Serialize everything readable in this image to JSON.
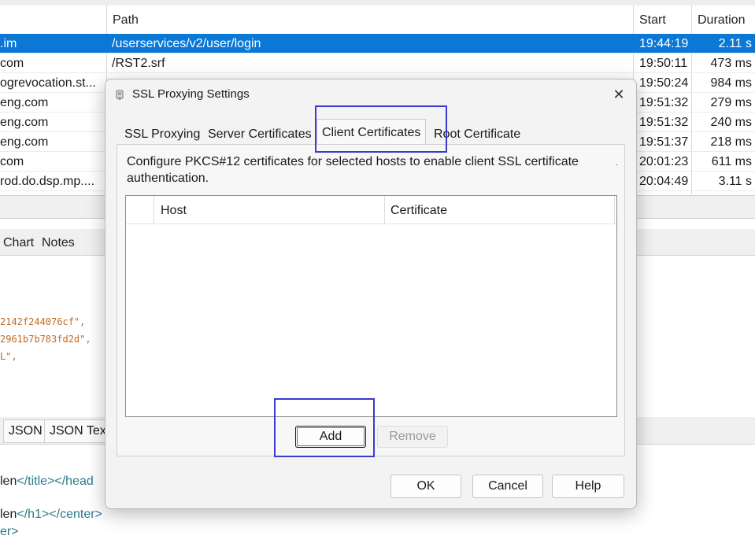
{
  "background": {
    "table": {
      "columns": {
        "path": "Path",
        "start": "Start",
        "duration": "Duration"
      },
      "rows": [
        {
          "host": ".im",
          "path": "/userservices/v2/user/login",
          "start": "19:44:19",
          "duration": "2.11 s",
          "selected": true
        },
        {
          "host": "com",
          "path": "/RST2.srf",
          "start": "19:50:11",
          "duration": "473 ms"
        },
        {
          "host": "ogrevocation.st...",
          "path": "",
          "start": "19:50:24",
          "duration": "984 ms"
        },
        {
          "host": "eng.com",
          "path": "",
          "start": "19:51:32",
          "duration": "279 ms"
        },
        {
          "host": "eng.com",
          "path": "",
          "start": "19:51:32",
          "duration": "240 ms"
        },
        {
          "host": "eng.com",
          "path": "",
          "start": "19:51:37",
          "duration": "218 ms"
        },
        {
          "host": "com",
          "path": "",
          "start": "20:01:23",
          "duration": "611 ms"
        },
        {
          "host": "rod.do.dsp.mp....",
          "path": "",
          "start": "20:04:49",
          "duration": "3.11 s"
        }
      ]
    },
    "lower_tabs": {
      "chart": "Chart",
      "notes": "Notes"
    },
    "code_lines": [
      "2142f244076cf\",",
      "2961b7b783fd2d\",",
      "L\","
    ],
    "response_tabs": {
      "json": "JSON",
      "json_text": "JSON Tex"
    },
    "html_lines": {
      "line1_text": "len",
      "line1_tags": "</title></head",
      "line2_text": "len",
      "line2_tags": "</h1></center>",
      "line3_tags": "er>"
    }
  },
  "dialog": {
    "title": "SSL Proxying Settings",
    "close_glyph": "✕",
    "tabs": [
      {
        "label": "SSL Proxying"
      },
      {
        "label": "Server Certificates"
      },
      {
        "label": "Client Certificates",
        "active": true
      },
      {
        "label": "Root Certificate"
      }
    ],
    "description": "Configure PKCS#12 certificates for selected hosts to enable client SSL certificate authentication.",
    "table": {
      "columns": [
        "Host",
        "Certificate"
      ]
    },
    "buttons": {
      "add": "Add",
      "remove": "Remove",
      "ok": "OK",
      "cancel": "Cancel",
      "help": "Help"
    }
  },
  "colors": {
    "selection": "#0b78d6",
    "highlight_box": "#3a3ad0",
    "code_string": "#c06a20",
    "html_tag": "#2a7a8a"
  },
  "icons": {
    "dialog": "certificate-icon",
    "close": "close-icon"
  }
}
